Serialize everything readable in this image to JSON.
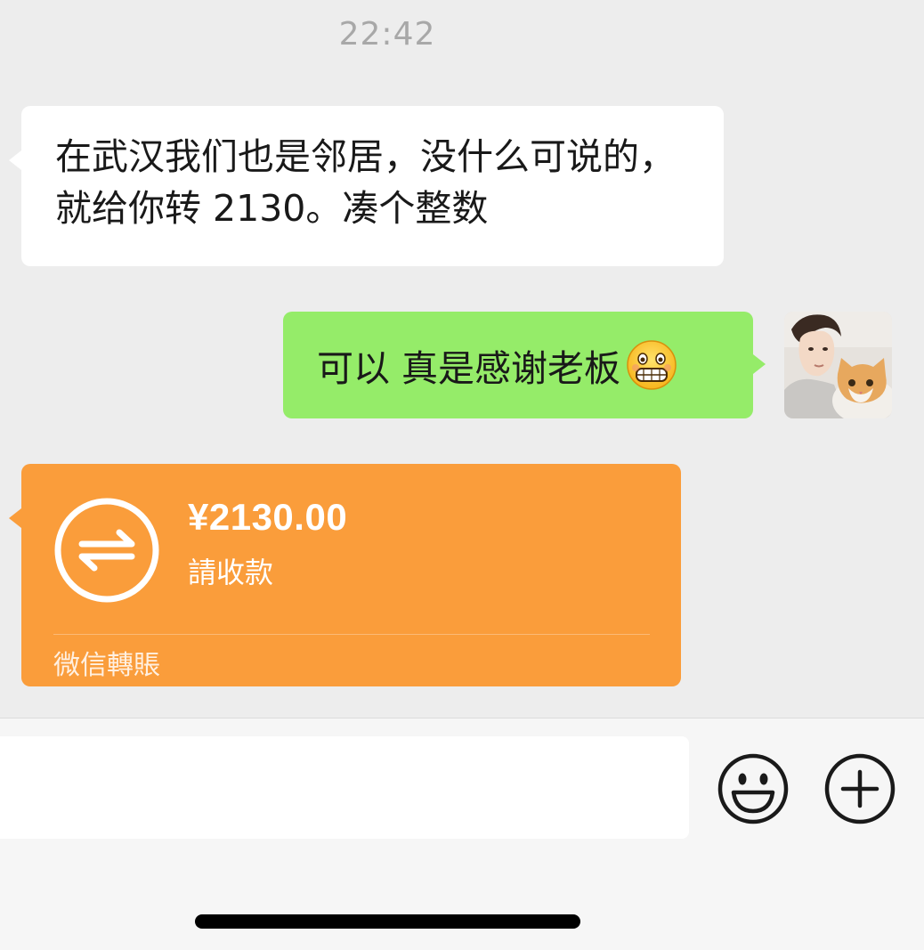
{
  "chat": {
    "timestamp": "22:42",
    "incoming_text": "在武汉我们也是邻居，没什么可说的，就给你转 2130。凑个整数",
    "outgoing_text": "可以 真是感谢老板",
    "outgoing_emoji": "grinning-face-icon",
    "avatar": "avatar-person-with-cat"
  },
  "transfer": {
    "amount": "¥2130.00",
    "status": "請收款",
    "footer": "微信轉賬",
    "icon": "transfer-arrows-icon"
  },
  "input_bar": {
    "placeholder": "",
    "emoji_icon": "smiley-icon",
    "plus_icon": "plus-circle-icon"
  },
  "colors": {
    "background": "#ededed",
    "incoming_bubble": "#ffffff",
    "outgoing_bubble": "#95ec69",
    "transfer_card": "#fa9d3b",
    "timestamp": "#a8a8a8"
  }
}
